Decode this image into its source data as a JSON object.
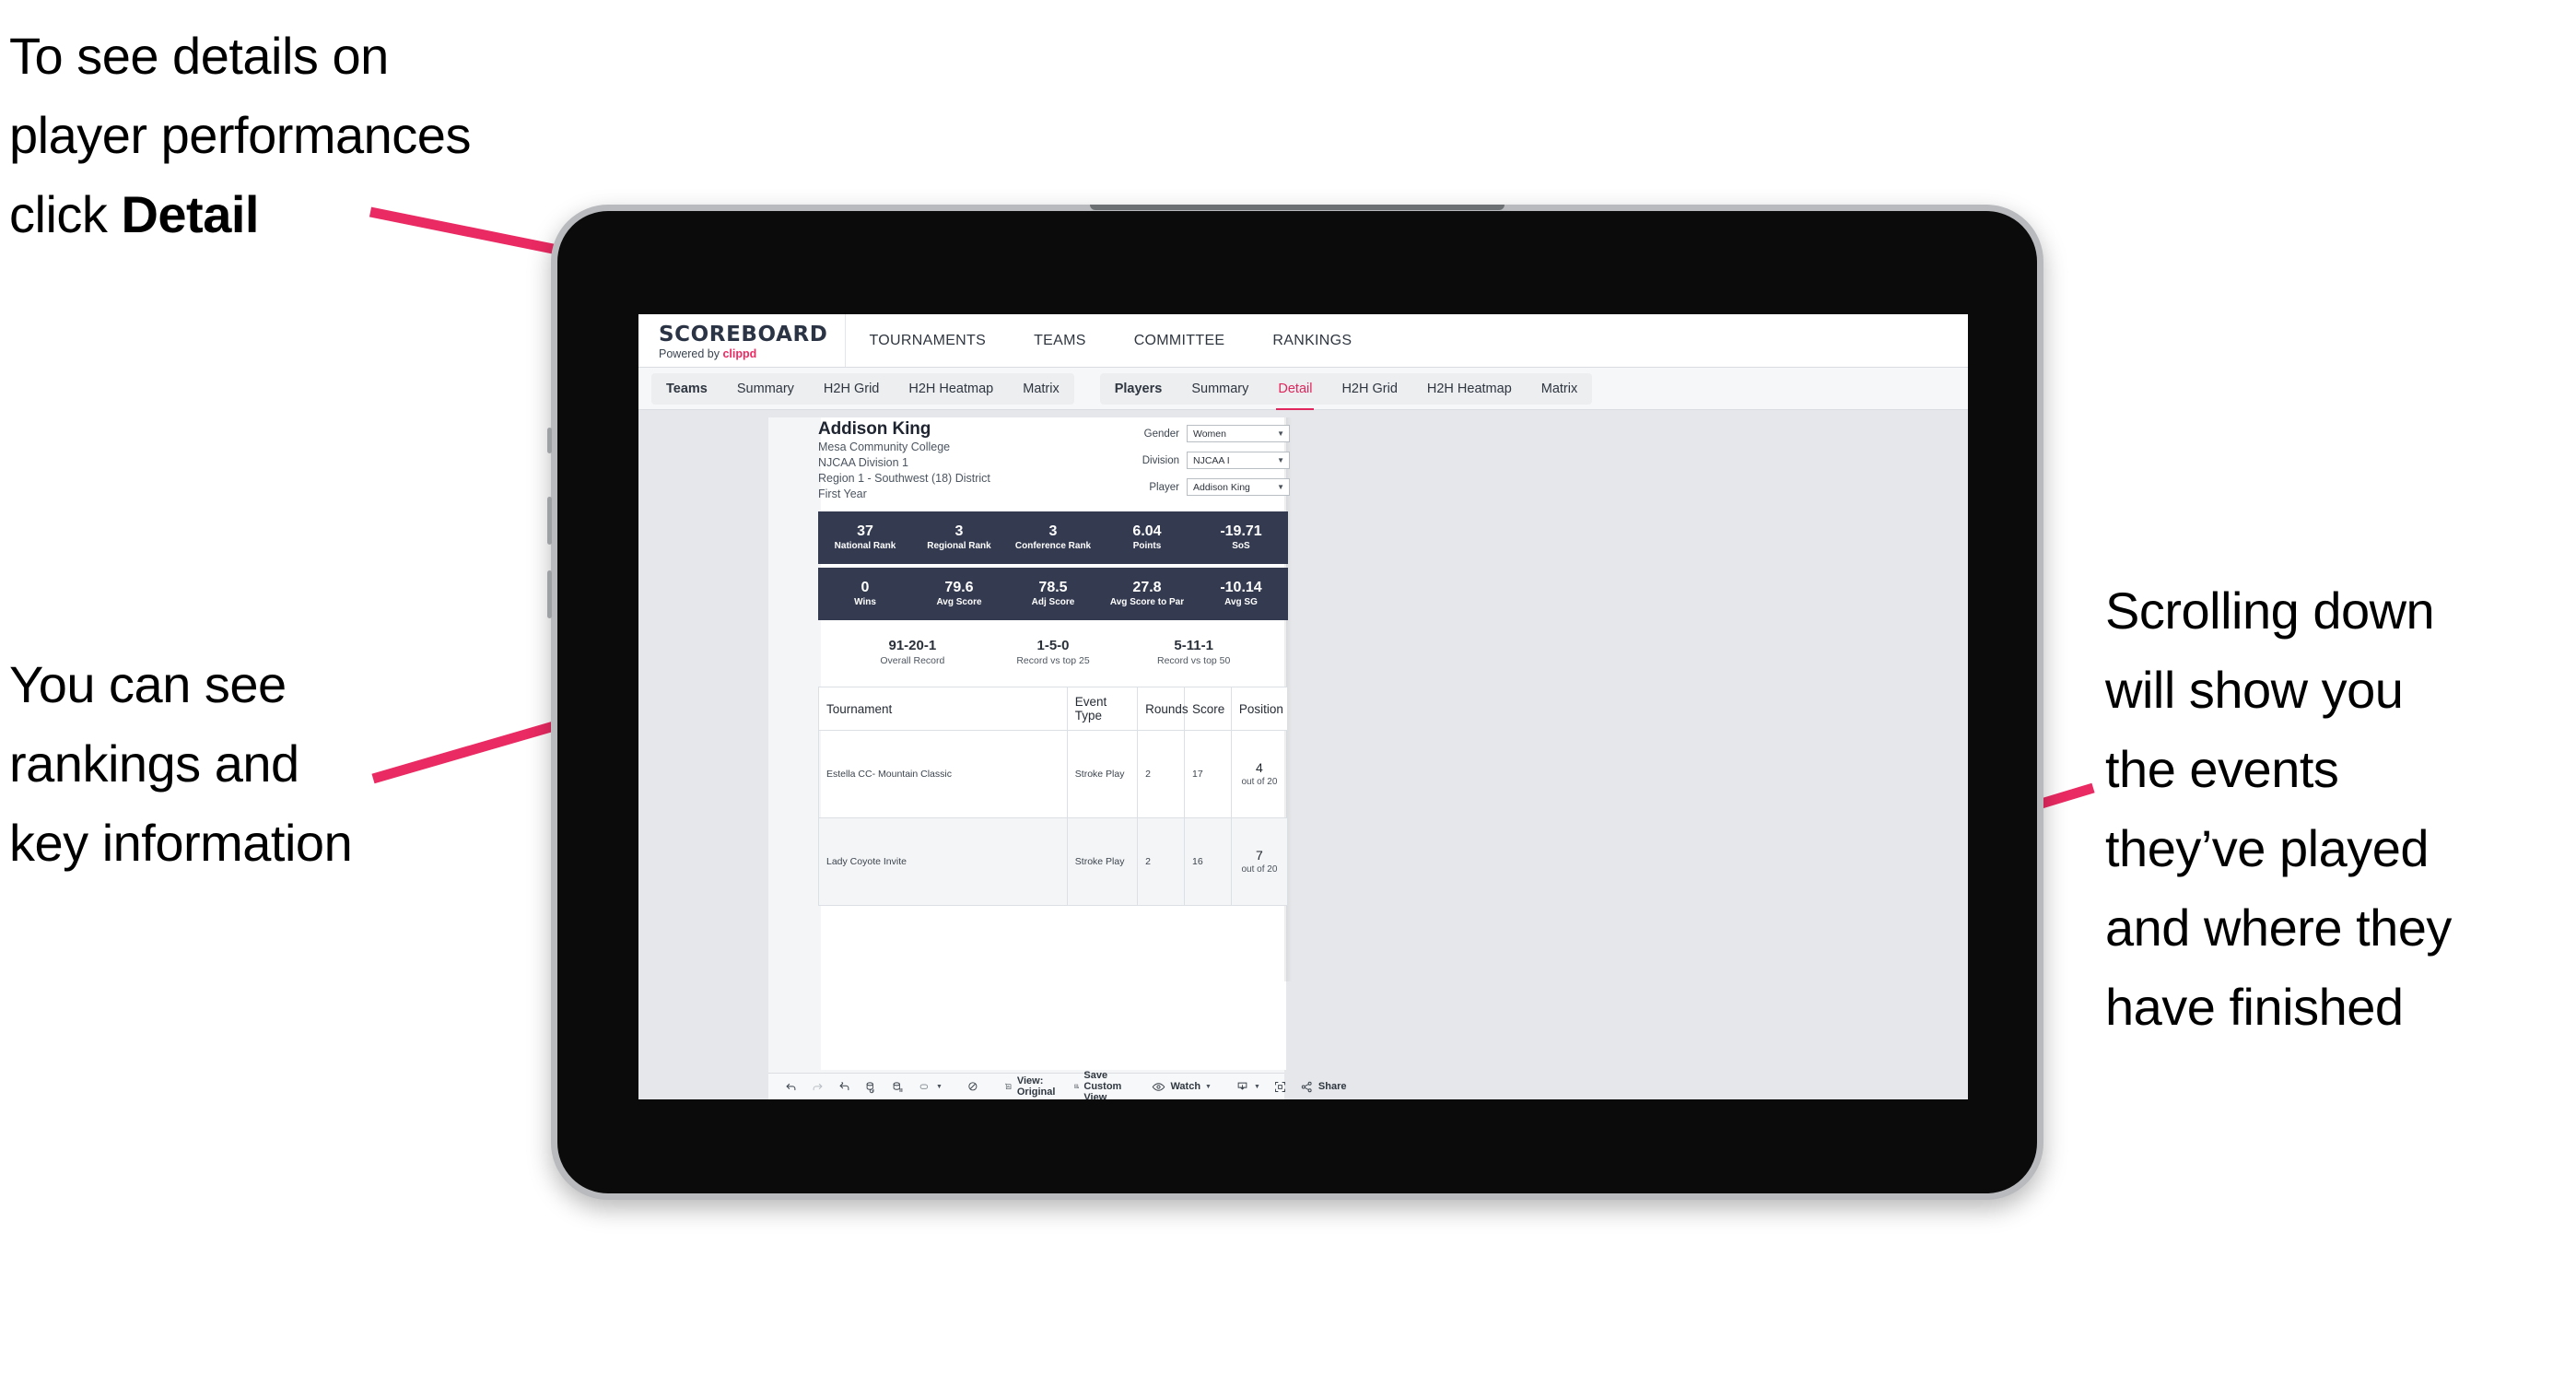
{
  "annotations": {
    "top_left": "To see details on\nplayer performances\nclick ",
    "top_left_bold": "Detail",
    "mid_left": "You can see\nrankings and\nkey information",
    "right": "Scrolling down\nwill show you\nthe events\nthey’ve played\nand where they\nhave finished",
    "arrow_color": "#ea2a62"
  },
  "app": {
    "brand": {
      "title": "SCOREBOARD",
      "powered_prefix": "Powered by ",
      "powered_brand": "clippd"
    },
    "top_nav": [
      {
        "label": "TOURNAMENTS"
      },
      {
        "label": "TEAMS"
      },
      {
        "label": "COMMITTEE"
      },
      {
        "label": "RANKINGS"
      }
    ],
    "tab_groups": [
      {
        "name": "teams-tabs",
        "tabs": [
          {
            "label": "Teams",
            "head": true,
            "active": false
          },
          {
            "label": "Summary",
            "head": false,
            "active": false
          },
          {
            "label": "H2H Grid",
            "head": false,
            "active": false
          },
          {
            "label": "H2H Heatmap",
            "head": false,
            "active": false
          },
          {
            "label": "Matrix",
            "head": false,
            "active": false
          }
        ]
      },
      {
        "name": "players-tabs",
        "tabs": [
          {
            "label": "Players",
            "head": true,
            "active": false
          },
          {
            "label": "Summary",
            "head": false,
            "active": false
          },
          {
            "label": "Detail",
            "head": false,
            "active": true
          },
          {
            "label": "H2H Grid",
            "head": false,
            "active": false
          },
          {
            "label": "H2H Heatmap",
            "head": false,
            "active": false
          },
          {
            "label": "Matrix",
            "head": false,
            "active": false
          }
        ]
      }
    ]
  },
  "player": {
    "name": "Addison King",
    "school": "Mesa Community College",
    "division": "NJCAA Division 1",
    "region": "Region 1 - Southwest (18) District",
    "year": "First Year"
  },
  "filters": [
    {
      "label": "Gender",
      "value": "Women"
    },
    {
      "label": "Division",
      "value": "NJCAA I"
    },
    {
      "label": "Player",
      "value": "Addison King"
    }
  ],
  "stats_row_1": [
    {
      "value": "37",
      "label": "National Rank"
    },
    {
      "value": "3",
      "label": "Regional Rank"
    },
    {
      "value": "3",
      "label": "Conference Rank"
    },
    {
      "value": "6.04",
      "label": "Points"
    },
    {
      "value": "-19.71",
      "label": "SoS"
    }
  ],
  "stats_row_2": [
    {
      "value": "0",
      "label": "Wins"
    },
    {
      "value": "79.6",
      "label": "Avg Score"
    },
    {
      "value": "78.5",
      "label": "Adj Score"
    },
    {
      "value": "27.8",
      "label": "Avg Score to Par"
    },
    {
      "value": "-10.14",
      "label": "Avg SG"
    }
  ],
  "records": [
    {
      "value": "91-20-1",
      "label": "Overall Record"
    },
    {
      "value": "1-5-0",
      "label": "Record vs top 25"
    },
    {
      "value": "5-11-1",
      "label": "Record vs top 50"
    }
  ],
  "table": {
    "columns": [
      "Tournament",
      "Event Type",
      "Rounds",
      "Score",
      "Position"
    ],
    "rows": [
      {
        "tournament": "Estella CC- Mountain Classic",
        "event_type": "Stroke Play",
        "rounds": "2",
        "score": "17",
        "position_number": "4",
        "position_out_of": "out of 20"
      },
      {
        "tournament": "Lady Coyote Invite",
        "event_type": "Stroke Play",
        "rounds": "2",
        "score": "16",
        "position_number": "7",
        "position_out_of": "out of 20"
      }
    ]
  },
  "toolbar": {
    "view_label": "View: Original",
    "save_label": "Save Custom View",
    "watch_label": "Watch",
    "share_label": "Share"
  },
  "colors": {
    "accent_pink": "#ea2a62",
    "stat_bar": "#343b51",
    "tab_active": "#e0265c",
    "screen_bg": "#e5e7ea"
  }
}
